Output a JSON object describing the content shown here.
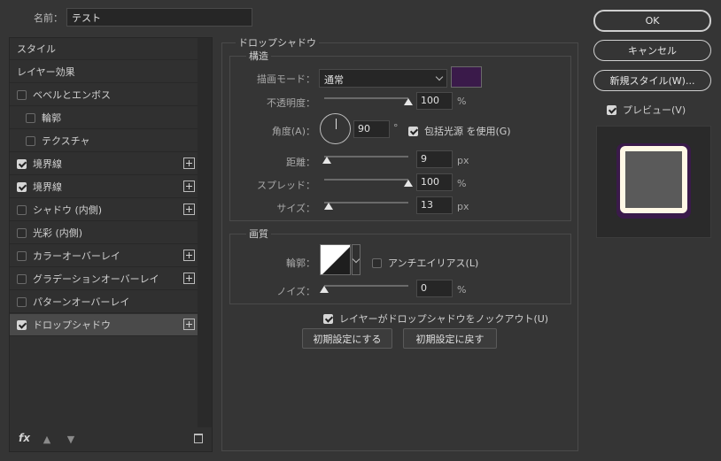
{
  "header": {
    "name_label": "名前：",
    "name_value": "テスト"
  },
  "styles": [
    {
      "label": "スタイル",
      "checkbox": false,
      "checked": false,
      "plus": false,
      "indent": false,
      "selected": false
    },
    {
      "label": "レイヤー効果",
      "checkbox": false,
      "checked": false,
      "plus": false,
      "indent": false,
      "selected": false
    },
    {
      "label": "ベベルとエンボス",
      "checkbox": true,
      "checked": false,
      "plus": false,
      "indent": false,
      "selected": false
    },
    {
      "label": "輪郭",
      "checkbox": true,
      "checked": false,
      "plus": false,
      "indent": true,
      "selected": false
    },
    {
      "label": "テクスチャ",
      "checkbox": true,
      "checked": false,
      "plus": false,
      "indent": true,
      "selected": false
    },
    {
      "label": "境界線",
      "checkbox": true,
      "checked": true,
      "plus": true,
      "indent": false,
      "selected": false
    },
    {
      "label": "境界線",
      "checkbox": true,
      "checked": true,
      "plus": true,
      "indent": false,
      "selected": false
    },
    {
      "label": "シャドウ (内側)",
      "checkbox": true,
      "checked": false,
      "plus": true,
      "indent": false,
      "selected": false
    },
    {
      "label": "光彩 (内側)",
      "checkbox": true,
      "checked": false,
      "plus": false,
      "indent": false,
      "selected": false
    },
    {
      "label": "カラーオーバーレイ",
      "checkbox": true,
      "checked": false,
      "plus": true,
      "indent": false,
      "selected": false
    },
    {
      "label": "グラデーションオーバーレイ",
      "checkbox": true,
      "checked": false,
      "plus": true,
      "indent": false,
      "selected": false
    },
    {
      "label": "パターンオーバーレイ",
      "checkbox": true,
      "checked": false,
      "plus": false,
      "indent": false,
      "selected": false
    },
    {
      "label": "ドロップシャドウ",
      "checkbox": true,
      "checked": true,
      "plus": true,
      "indent": false,
      "selected": true
    }
  ],
  "list_footer": {
    "fx_label": "fx",
    "up_icon": "arrow-up-icon",
    "down_icon": "arrow-down-icon",
    "trash_icon": "trash-icon"
  },
  "drop_shadow": {
    "title": "ドロップシャドウ",
    "structure": {
      "title": "構造",
      "blend_mode_label": "描画モード：",
      "blend_mode_value": "通常",
      "color": "#3a1a4a",
      "opacity_label": "不透明度：",
      "opacity_value": "100",
      "opacity_unit": "%",
      "opacity_fraction": 1.0,
      "angle_label": "角度(A)：",
      "angle_value": "90",
      "angle_unit": "°",
      "global_light_label": "包括光源 を使用(G)",
      "global_light_checked": true,
      "distance_label": "距離：",
      "distance_value": "9",
      "distance_unit": "px",
      "distance_fraction": 0.03,
      "spread_label": "スプレッド：",
      "spread_value": "100",
      "spread_unit": "%",
      "spread_fraction": 1.0,
      "size_label": "サイズ：",
      "size_value": "13",
      "size_unit": "px",
      "size_fraction": 0.05
    },
    "quality": {
      "title": "画質",
      "contour_label": "輪郭：",
      "antialias_label": "アンチエイリアス(L)",
      "antialias_checked": false,
      "noise_label": "ノイズ：",
      "noise_value": "0",
      "noise_unit": "%",
      "noise_fraction": 0.0
    },
    "knockout_label": "レイヤーがドロップシャドウをノックアウト(U)",
    "knockout_checked": true,
    "make_default_label": "初期設定にする",
    "reset_default_label": "初期設定に戻す"
  },
  "actions": {
    "ok_label": "OK",
    "cancel_label": "キャンセル",
    "new_style_label": "新規スタイル(W)...",
    "preview_label": "プレビュー(V)",
    "preview_checked": true
  },
  "colors": {
    "accent_purple": "#3a1a4a",
    "preview_fill": "#5a5a5a",
    "preview_border": "#fff8e6"
  }
}
